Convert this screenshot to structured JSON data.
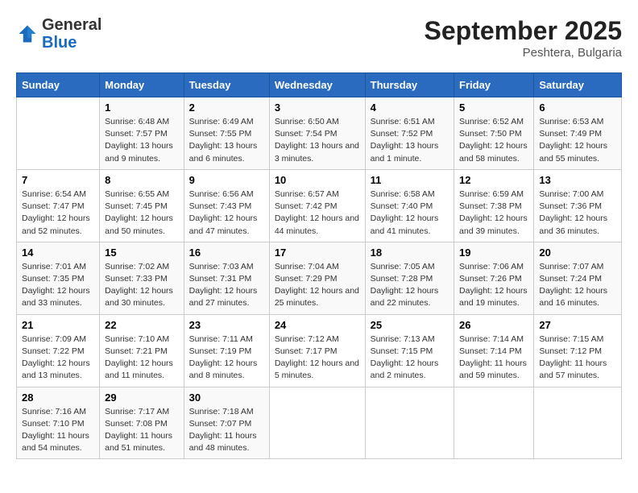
{
  "header": {
    "logo_general": "General",
    "logo_blue": "Blue",
    "month_title": "September 2025",
    "location": "Peshtera, Bulgaria"
  },
  "days_of_week": [
    "Sunday",
    "Monday",
    "Tuesday",
    "Wednesday",
    "Thursday",
    "Friday",
    "Saturday"
  ],
  "weeks": [
    [
      {
        "num": "",
        "sunrise": "",
        "sunset": "",
        "daylight": ""
      },
      {
        "num": "1",
        "sunrise": "Sunrise: 6:48 AM",
        "sunset": "Sunset: 7:57 PM",
        "daylight": "Daylight: 13 hours and 9 minutes."
      },
      {
        "num": "2",
        "sunrise": "Sunrise: 6:49 AM",
        "sunset": "Sunset: 7:55 PM",
        "daylight": "Daylight: 13 hours and 6 minutes."
      },
      {
        "num": "3",
        "sunrise": "Sunrise: 6:50 AM",
        "sunset": "Sunset: 7:54 PM",
        "daylight": "Daylight: 13 hours and 3 minutes."
      },
      {
        "num": "4",
        "sunrise": "Sunrise: 6:51 AM",
        "sunset": "Sunset: 7:52 PM",
        "daylight": "Daylight: 13 hours and 1 minute."
      },
      {
        "num": "5",
        "sunrise": "Sunrise: 6:52 AM",
        "sunset": "Sunset: 7:50 PM",
        "daylight": "Daylight: 12 hours and 58 minutes."
      },
      {
        "num": "6",
        "sunrise": "Sunrise: 6:53 AM",
        "sunset": "Sunset: 7:49 PM",
        "daylight": "Daylight: 12 hours and 55 minutes."
      }
    ],
    [
      {
        "num": "7",
        "sunrise": "Sunrise: 6:54 AM",
        "sunset": "Sunset: 7:47 PM",
        "daylight": "Daylight: 12 hours and 52 minutes."
      },
      {
        "num": "8",
        "sunrise": "Sunrise: 6:55 AM",
        "sunset": "Sunset: 7:45 PM",
        "daylight": "Daylight: 12 hours and 50 minutes."
      },
      {
        "num": "9",
        "sunrise": "Sunrise: 6:56 AM",
        "sunset": "Sunset: 7:43 PM",
        "daylight": "Daylight: 12 hours and 47 minutes."
      },
      {
        "num": "10",
        "sunrise": "Sunrise: 6:57 AM",
        "sunset": "Sunset: 7:42 PM",
        "daylight": "Daylight: 12 hours and 44 minutes."
      },
      {
        "num": "11",
        "sunrise": "Sunrise: 6:58 AM",
        "sunset": "Sunset: 7:40 PM",
        "daylight": "Daylight: 12 hours and 41 minutes."
      },
      {
        "num": "12",
        "sunrise": "Sunrise: 6:59 AM",
        "sunset": "Sunset: 7:38 PM",
        "daylight": "Daylight: 12 hours and 39 minutes."
      },
      {
        "num": "13",
        "sunrise": "Sunrise: 7:00 AM",
        "sunset": "Sunset: 7:36 PM",
        "daylight": "Daylight: 12 hours and 36 minutes."
      }
    ],
    [
      {
        "num": "14",
        "sunrise": "Sunrise: 7:01 AM",
        "sunset": "Sunset: 7:35 PM",
        "daylight": "Daylight: 12 hours and 33 minutes."
      },
      {
        "num": "15",
        "sunrise": "Sunrise: 7:02 AM",
        "sunset": "Sunset: 7:33 PM",
        "daylight": "Daylight: 12 hours and 30 minutes."
      },
      {
        "num": "16",
        "sunrise": "Sunrise: 7:03 AM",
        "sunset": "Sunset: 7:31 PM",
        "daylight": "Daylight: 12 hours and 27 minutes."
      },
      {
        "num": "17",
        "sunrise": "Sunrise: 7:04 AM",
        "sunset": "Sunset: 7:29 PM",
        "daylight": "Daylight: 12 hours and 25 minutes."
      },
      {
        "num": "18",
        "sunrise": "Sunrise: 7:05 AM",
        "sunset": "Sunset: 7:28 PM",
        "daylight": "Daylight: 12 hours and 22 minutes."
      },
      {
        "num": "19",
        "sunrise": "Sunrise: 7:06 AM",
        "sunset": "Sunset: 7:26 PM",
        "daylight": "Daylight: 12 hours and 19 minutes."
      },
      {
        "num": "20",
        "sunrise": "Sunrise: 7:07 AM",
        "sunset": "Sunset: 7:24 PM",
        "daylight": "Daylight: 12 hours and 16 minutes."
      }
    ],
    [
      {
        "num": "21",
        "sunrise": "Sunrise: 7:09 AM",
        "sunset": "Sunset: 7:22 PM",
        "daylight": "Daylight: 12 hours and 13 minutes."
      },
      {
        "num": "22",
        "sunrise": "Sunrise: 7:10 AM",
        "sunset": "Sunset: 7:21 PM",
        "daylight": "Daylight: 12 hours and 11 minutes."
      },
      {
        "num": "23",
        "sunrise": "Sunrise: 7:11 AM",
        "sunset": "Sunset: 7:19 PM",
        "daylight": "Daylight: 12 hours and 8 minutes."
      },
      {
        "num": "24",
        "sunrise": "Sunrise: 7:12 AM",
        "sunset": "Sunset: 7:17 PM",
        "daylight": "Daylight: 12 hours and 5 minutes."
      },
      {
        "num": "25",
        "sunrise": "Sunrise: 7:13 AM",
        "sunset": "Sunset: 7:15 PM",
        "daylight": "Daylight: 12 hours and 2 minutes."
      },
      {
        "num": "26",
        "sunrise": "Sunrise: 7:14 AM",
        "sunset": "Sunset: 7:14 PM",
        "daylight": "Daylight: 11 hours and 59 minutes."
      },
      {
        "num": "27",
        "sunrise": "Sunrise: 7:15 AM",
        "sunset": "Sunset: 7:12 PM",
        "daylight": "Daylight: 11 hours and 57 minutes."
      }
    ],
    [
      {
        "num": "28",
        "sunrise": "Sunrise: 7:16 AM",
        "sunset": "Sunset: 7:10 PM",
        "daylight": "Daylight: 11 hours and 54 minutes."
      },
      {
        "num": "29",
        "sunrise": "Sunrise: 7:17 AM",
        "sunset": "Sunset: 7:08 PM",
        "daylight": "Daylight: 11 hours and 51 minutes."
      },
      {
        "num": "30",
        "sunrise": "Sunrise: 7:18 AM",
        "sunset": "Sunset: 7:07 PM",
        "daylight": "Daylight: 11 hours and 48 minutes."
      },
      {
        "num": "",
        "sunrise": "",
        "sunset": "",
        "daylight": ""
      },
      {
        "num": "",
        "sunrise": "",
        "sunset": "",
        "daylight": ""
      },
      {
        "num": "",
        "sunrise": "",
        "sunset": "",
        "daylight": ""
      },
      {
        "num": "",
        "sunrise": "",
        "sunset": "",
        "daylight": ""
      }
    ]
  ]
}
